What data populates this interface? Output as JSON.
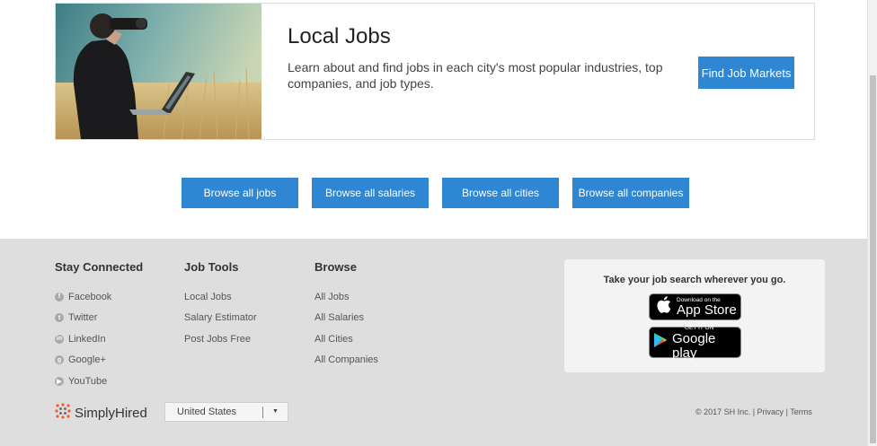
{
  "local_jobs": {
    "title": "Local Jobs",
    "description": "Learn about and find jobs in each city's most popular industries, top companies, and job types.",
    "button": "Find Job Markets"
  },
  "browse_buttons": [
    "Browse all jobs",
    "Browse all salaries",
    "Browse all cities",
    "Browse all companies"
  ],
  "footer": {
    "stay_connected": {
      "heading": "Stay Connected",
      "items": [
        "Facebook",
        "Twitter",
        "LinkedIn",
        "Google+",
        "YouTube"
      ]
    },
    "job_tools": {
      "heading": "Job Tools",
      "items": [
        "Local Jobs",
        "Salary Estimator",
        "Post Jobs Free"
      ]
    },
    "browse": {
      "heading": "Browse",
      "items": [
        "All Jobs",
        "All Salaries",
        "All Cities",
        "All Companies"
      ]
    },
    "apps": {
      "tagline": "Take your job search wherever you go.",
      "apple_small": "Download on the",
      "apple_big": "App Store",
      "google_small": "GET IT ON",
      "google_big": "Google play"
    },
    "logo_text": "SimplyHired",
    "country": "United States",
    "copyright": "© 2017 SH Inc.",
    "privacy": "Privacy",
    "terms": "Terms",
    "separator": "|"
  },
  "colors": {
    "primary_button": "#2f86d2",
    "footer_bg": "#dedede",
    "app_box_bg": "#f3f3f3"
  }
}
